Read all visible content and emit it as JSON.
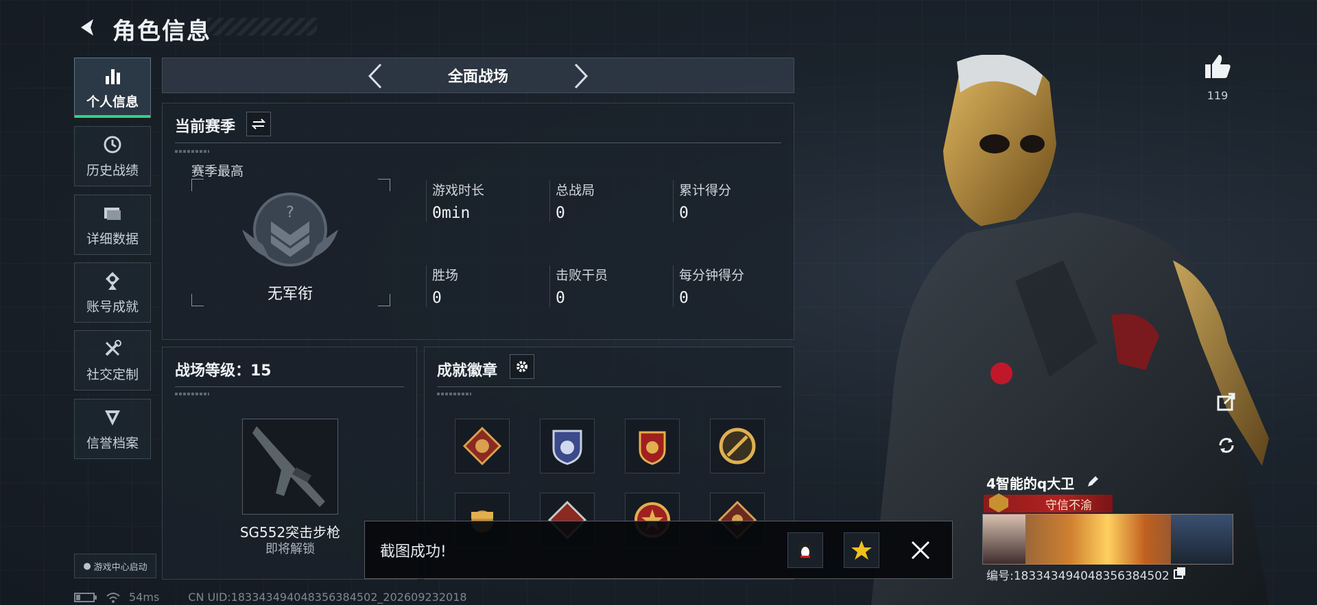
{
  "header": {
    "title": "角色信息"
  },
  "sidebar": {
    "items": [
      {
        "label": "个人信息",
        "icon": "bar-chart-icon",
        "active": true
      },
      {
        "label": "历史战绩",
        "icon": "clock-icon",
        "active": false
      },
      {
        "label": "详细数据",
        "icon": "folder-icon",
        "active": false
      },
      {
        "label": "账号成就",
        "icon": "medal-icon",
        "active": false
      },
      {
        "label": "社交定制",
        "icon": "tools-icon",
        "active": false
      },
      {
        "label": "信誉档案",
        "icon": "shield-icon",
        "active": false
      }
    ],
    "game_center_label": "游戏中心启动"
  },
  "mode_bar": {
    "title": "全面战场"
  },
  "season": {
    "title": "当前赛季",
    "best_label": "赛季最高",
    "rank_name": "无军衔",
    "stats": [
      {
        "label": "游戏时长",
        "value": "0min"
      },
      {
        "label": "总战局",
        "value": "0"
      },
      {
        "label": "累计得分",
        "value": "0"
      },
      {
        "label": "胜场",
        "value": "0"
      },
      {
        "label": "击败干员",
        "value": "0"
      },
      {
        "label": "每分钟得分",
        "value": "0"
      }
    ]
  },
  "battle_level": {
    "title": "战场等级：15",
    "weapon_name": "SG552突击步枪",
    "weapon_status": "即将解锁"
  },
  "achievements": {
    "title": "成就徽章",
    "badges": [
      {
        "name": "wolf-diamond-badge-icon"
      },
      {
        "name": "blue-shield-badge-icon"
      },
      {
        "name": "red-gold-badge-icon"
      },
      {
        "name": "gold-emblem-badge-icon"
      },
      {
        "name": "gold-fist-badge-icon"
      },
      {
        "name": "red-diamond-badge-icon"
      },
      {
        "name": "star-medal-badge-icon"
      },
      {
        "name": "dragon-diamond-badge-icon"
      }
    ]
  },
  "toast": {
    "message": "截图成功!"
  },
  "profile": {
    "likes": "119",
    "player_name": "4智能的q大卫",
    "title_tag": "守信不渝",
    "id_label": "编号:1833434940483563845​02"
  },
  "status_bar": {
    "ping": "54ms",
    "uid": "CN UID:183343494048356384502_202609232018"
  },
  "colors": {
    "accent_green": "#35d08a",
    "title_red": "#b22222"
  }
}
